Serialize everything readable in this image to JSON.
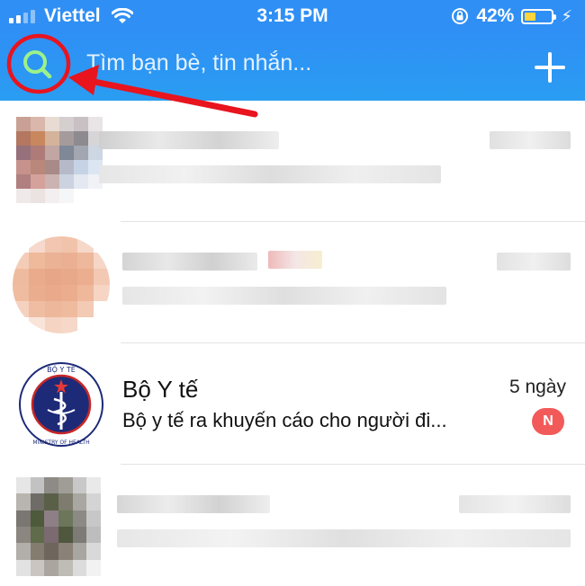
{
  "status_bar": {
    "carrier": "Viettel",
    "time": "3:15 PM",
    "battery_percent": "42%",
    "battery_level": 0.42,
    "signal_icon": "signal-bars-icon",
    "wifi_icon": "wifi-icon",
    "lock_icon": "orientation-lock-icon",
    "charging_icon": "charging-bolt-icon",
    "battery_color": "#ffd33c"
  },
  "header": {
    "search_icon": "search-icon",
    "search_placeholder": "Tìm bạn bè, tin nhắn...",
    "add_icon": "plus-icon",
    "background_color": "#2f8ff5"
  },
  "annotation": {
    "circle_color": "#e8141e",
    "arrow_color": "#e8141e"
  },
  "conversations": [
    {
      "blurred": true
    },
    {
      "blurred": true
    },
    {
      "title": "Bộ Y tế",
      "time": "5 ngày",
      "preview": "Bộ y tế ra khuyến cáo cho người đi...",
      "badge": "N",
      "logo_text": "BỘ Y TẾ",
      "logo_subtext": "MINISTRY OF HEALTH",
      "badge_color": "#f25a5a"
    },
    {
      "blurred": true
    }
  ]
}
